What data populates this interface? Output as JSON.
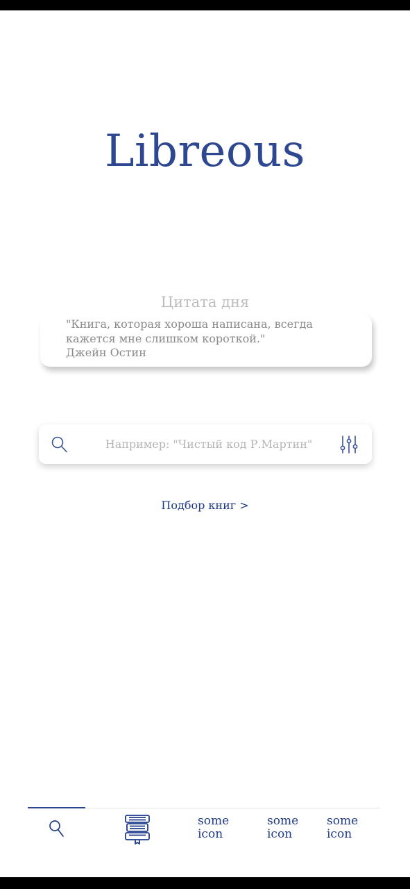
{
  "app": {
    "title": "Libreous"
  },
  "quote_of_day": {
    "heading": "Цитата дня",
    "text": "\"Книга, которая хороша написана, всегда\nкажется мне слишком короткой.\"\nДжейн Остин"
  },
  "search": {
    "placeholder": "Например: \"Чистый код Р.Мартин\"",
    "value": ""
  },
  "book_selection": {
    "label": "Подбор книг >"
  },
  "bottom_nav": {
    "items": [
      {
        "icon": "search-icon",
        "active": true
      },
      {
        "icon": "books-stack-icon",
        "active": false
      },
      {
        "label": "some\nicon"
      },
      {
        "label": "some\nicon"
      },
      {
        "label": "some\nicon"
      }
    ]
  },
  "colors": {
    "brand": "#2e4791",
    "link": "#1f3a8a",
    "muted": "#bdbdbd",
    "quote_text": "#8a8a8a"
  }
}
